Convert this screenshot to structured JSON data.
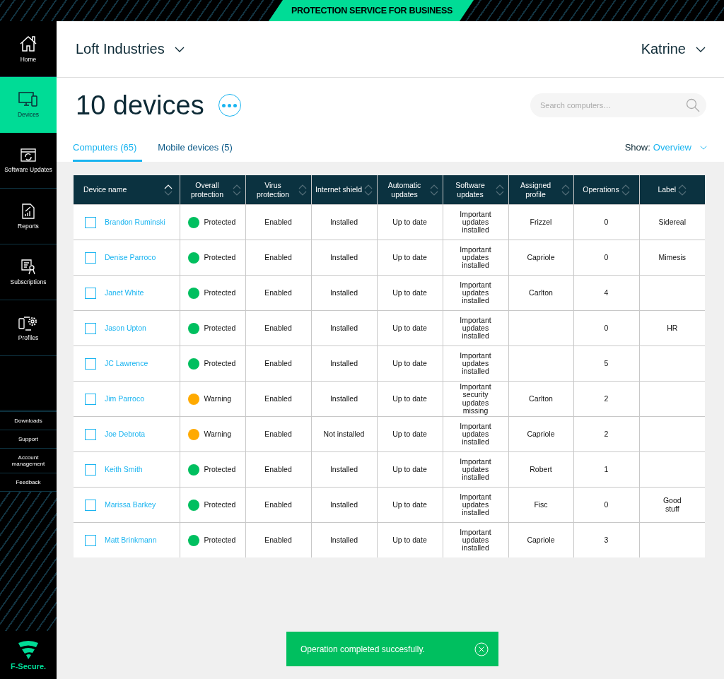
{
  "banner": "PROTECTION SERVICE FOR BUSINESS",
  "sidebar": {
    "items": [
      {
        "kind": "home",
        "label": "Home",
        "selected": false
      },
      {
        "kind": "devices",
        "label": "Devices",
        "selected": true
      },
      {
        "kind": "updates",
        "label": "Software Updates",
        "selected": false
      },
      {
        "kind": "reports",
        "label": "Reports",
        "selected": false
      },
      {
        "kind": "subscriptions",
        "label": "Subscriptions",
        "selected": false
      },
      {
        "kind": "profiles",
        "label": "Profiles",
        "selected": false
      }
    ],
    "links": [
      "Downloads",
      "Support",
      "Account management",
      "Feedback"
    ],
    "logo": "F-Secure."
  },
  "header": {
    "company": "Loft Industries",
    "user": "Katrine"
  },
  "title": "10 devices",
  "search": {
    "placeholder": "Search computers…"
  },
  "tabs": [
    {
      "label": "Computers (65)",
      "selected": true
    },
    {
      "label": "Mobile devices (5)",
      "selected": false
    }
  ],
  "show": {
    "label": "Show:",
    "value": "Overview"
  },
  "table": {
    "columns": [
      "Device name",
      "Overall protection",
      "Virus protection",
      "Internet shield",
      "Automatic updates",
      "Software updates",
      "Assigned profile",
      "Operations",
      "Label"
    ],
    "rows": [
      {
        "checked": false,
        "name": "Brandon Ruminski",
        "status": "Protected",
        "color": "#00bf5f",
        "virus": "Enabled",
        "shield": "Installed",
        "auto": "Up to date",
        "software": "Important updates installed",
        "profile": "Frizzel",
        "operations": "0",
        "label": "Sidereal"
      },
      {
        "checked": false,
        "name": "Denise Parroco",
        "status": "Protected",
        "color": "#00bf5f",
        "virus": "Enabled",
        "shield": "Installed",
        "auto": "Up to date",
        "software": "Important updates installed",
        "profile": "Capriole",
        "operations": "0",
        "label": "Mimesis"
      },
      {
        "checked": false,
        "name": "Janet White",
        "status": "Protected",
        "color": "#00bf5f",
        "virus": "Enabled",
        "shield": "Installed",
        "auto": "Up to date",
        "software": "Important updates installed",
        "profile": "Carlton",
        "operations": "4",
        "label": ""
      },
      {
        "checked": false,
        "name": "Jason Upton",
        "status": "Protected",
        "color": "#00bf5f",
        "virus": "Enabled",
        "shield": "Installed",
        "auto": "Up to date",
        "software": "Important updates installed",
        "profile": "",
        "operations": "0",
        "label": "HR"
      },
      {
        "checked": false,
        "name": "JC Lawrence",
        "status": "Protected",
        "color": "#00bf5f",
        "virus": "Enabled",
        "shield": "Installed",
        "auto": "Up to date",
        "software": "Important updates installed",
        "profile": "",
        "operations": "5",
        "label": ""
      },
      {
        "checked": false,
        "name": "Jim Parroco",
        "status": "Warning",
        "color": "#ffaa00",
        "virus": "Enabled",
        "shield": "Installed",
        "auto": "Up to date",
        "software": "Important security updates missing",
        "profile": "Carlton",
        "operations": "2",
        "label": ""
      },
      {
        "checked": false,
        "name": "Joe Debrota",
        "status": "Warning",
        "color": "#ffaa00",
        "virus": "Enabled",
        "shield": "Not installed",
        "auto": "Up to date",
        "software": "Important updates installed",
        "profile": "Capriole",
        "operations": "2",
        "label": ""
      },
      {
        "checked": false,
        "name": "Keith Smith",
        "status": "Protected",
        "color": "#00bf5f",
        "virus": "Enabled",
        "shield": "Installed",
        "auto": "Up to date",
        "software": "Important updates installed",
        "profile": "Robert",
        "operations": "1",
        "label": ""
      },
      {
        "checked": false,
        "name": "Marissa Barkey",
        "status": "Protected",
        "color": "#00bf5f",
        "virus": "Enabled",
        "shield": "Installed",
        "auto": "Up to date",
        "software": "Important updates installed",
        "profile": "Fisc",
        "operations": "0",
        "label": "Good stuff"
      },
      {
        "checked": false,
        "name": "Matt Brinkmann",
        "status": "Protected",
        "color": "#00bf5f",
        "virus": "Enabled",
        "shield": "Installed",
        "auto": "Up to date",
        "software": "Important updates installed",
        "profile": "Capriole",
        "operations": "3",
        "label": ""
      }
    ]
  },
  "toast": {
    "message": "Operation completed succesfully."
  }
}
